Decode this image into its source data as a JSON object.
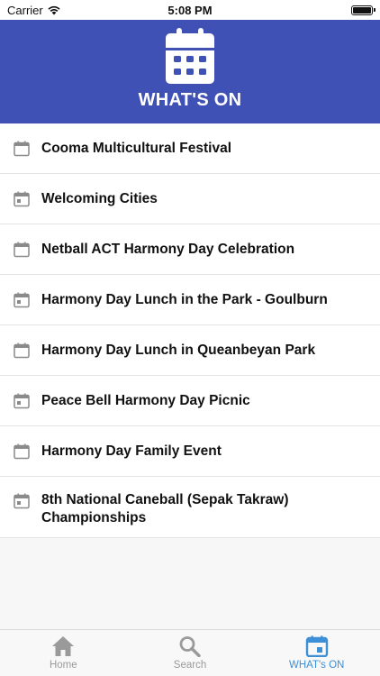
{
  "status_bar": {
    "carrier": "Carrier",
    "time": "5:08 PM"
  },
  "header": {
    "icon": "calendar-icon",
    "title": "WHAT'S ON",
    "background_color": "#3f51b5"
  },
  "events": [
    {
      "title": "Cooma Multicultural Festival"
    },
    {
      "title": "Welcoming Cities"
    },
    {
      "title": "Netball ACT Harmony Day Celebration"
    },
    {
      "title": "Harmony Day Lunch in the Park - Goulburn"
    },
    {
      "title": "Harmony Day Lunch in Queanbeyan Park"
    },
    {
      "title": "Peace Bell Harmony Day Picnic"
    },
    {
      "title": "Harmony Day Family Event"
    },
    {
      "title": "8th National Caneball (Sepak Takraw) Championships"
    }
  ],
  "tab_bar": {
    "tabs": [
      {
        "label": "Home",
        "icon": "home-icon",
        "active": false
      },
      {
        "label": "Search",
        "icon": "search-icon",
        "active": false
      },
      {
        "label": "WHAT's ON",
        "icon": "calendar-icon",
        "active": true
      }
    ],
    "active_color": "#3d8fd6",
    "inactive_color": "#9a9a9a"
  }
}
